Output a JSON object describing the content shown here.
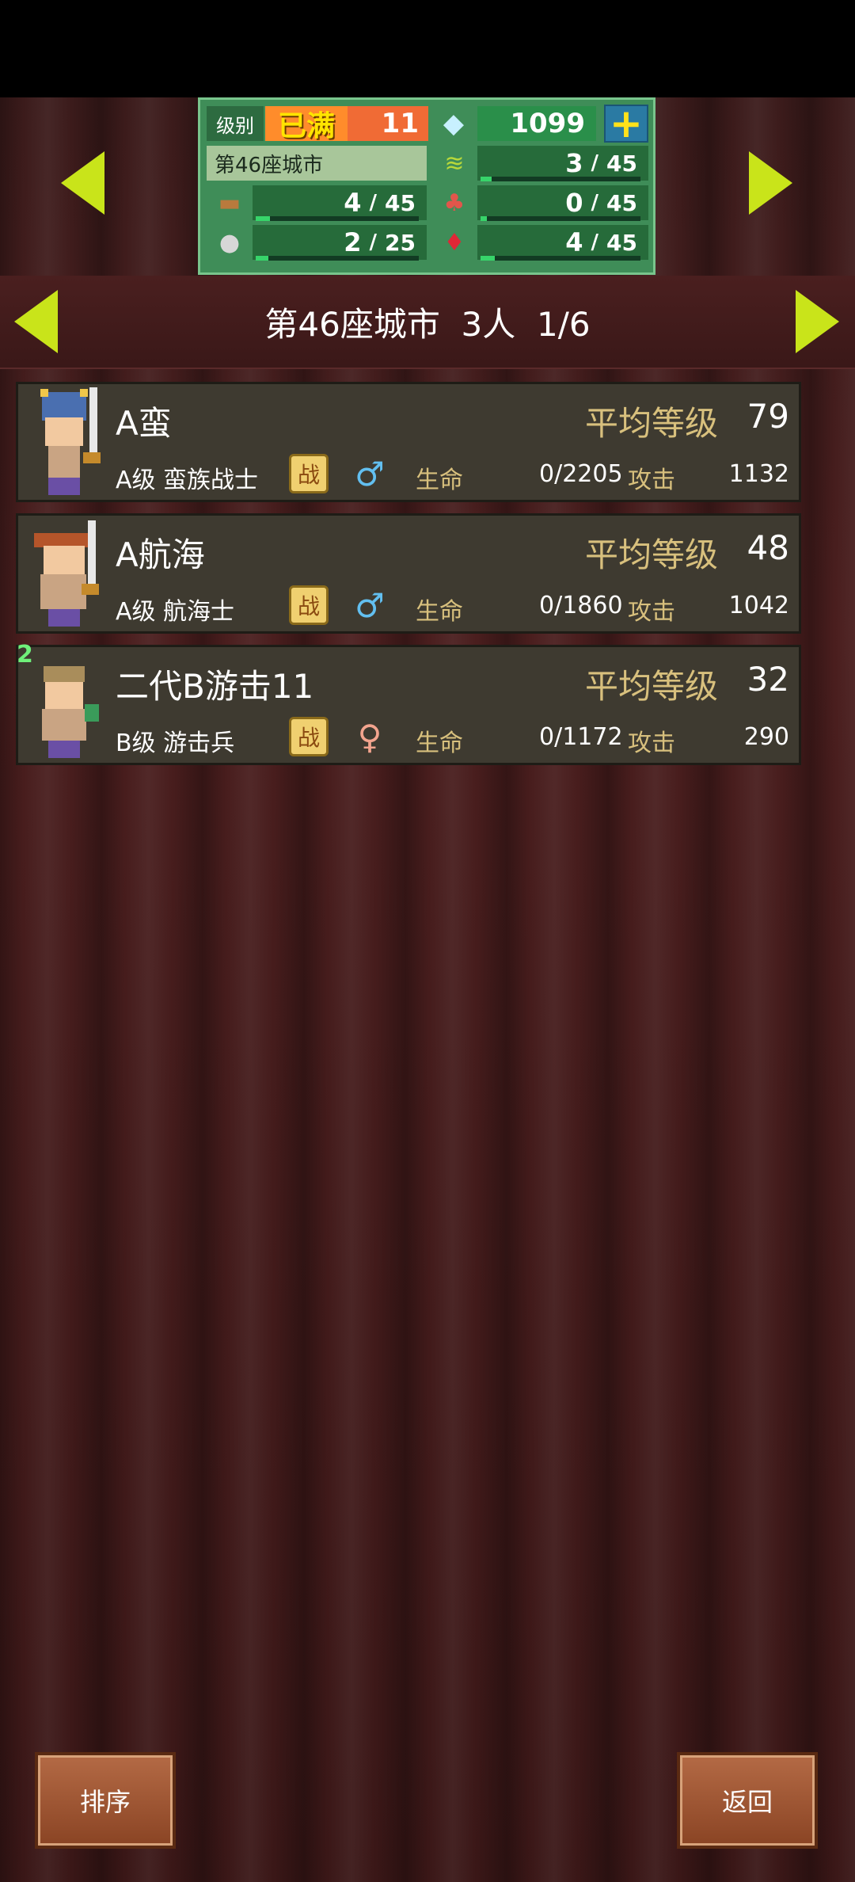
{
  "hud": {
    "level_label": "级别",
    "level_status": "已满",
    "level_value": "11",
    "gems": "1099",
    "city_name": "第46座城市",
    "resources": [
      {
        "icon": "grass-icon",
        "current": "3",
        "max": "45",
        "fill": 0.067
      },
      {
        "icon": "wood-icon",
        "current": "4",
        "max": "45",
        "fill": 0.089
      },
      {
        "icon": "food-icon",
        "current": "0",
        "max": "45",
        "fill": 0.0
      },
      {
        "icon": "stone-icon",
        "current": "2",
        "max": "25",
        "fill": 0.08
      },
      {
        "icon": "ruby-icon",
        "current": "4",
        "max": "45",
        "fill": 0.089
      }
    ]
  },
  "header": {
    "title": "第46座城市  3人  1/6"
  },
  "units": [
    {
      "name": "A蛮",
      "avg_label": "平均等级",
      "avg_level": "79",
      "class": "A级 蛮族战士",
      "battle": "战",
      "gender": "male",
      "hp_label": "生命",
      "hp": "0/2205",
      "atk_label": "攻击",
      "atk": "1132"
    },
    {
      "name": "A航海",
      "avg_label": "平均等级",
      "avg_level": "48",
      "class": "A级 航海士",
      "battle": "战",
      "gender": "male",
      "hp_label": "生命",
      "hp": "0/1860",
      "atk_label": "攻击",
      "atk": "1042"
    },
    {
      "name": "二代B游击11",
      "avg_label": "平均等级",
      "avg_level": "32",
      "class": "B级 游击兵",
      "battle": "战",
      "gender": "female",
      "gen_badge": "2",
      "hp_label": "生命",
      "hp": "0/1172",
      "atk_label": "攻击",
      "atk": "290"
    }
  ],
  "buttons": {
    "sort": "排序",
    "back": "返回"
  },
  "colors": {
    "accent_arrow": "#c9e41a",
    "label_gold": "#d8c07d",
    "male": "#62bff0",
    "female": "#f3a48e"
  }
}
